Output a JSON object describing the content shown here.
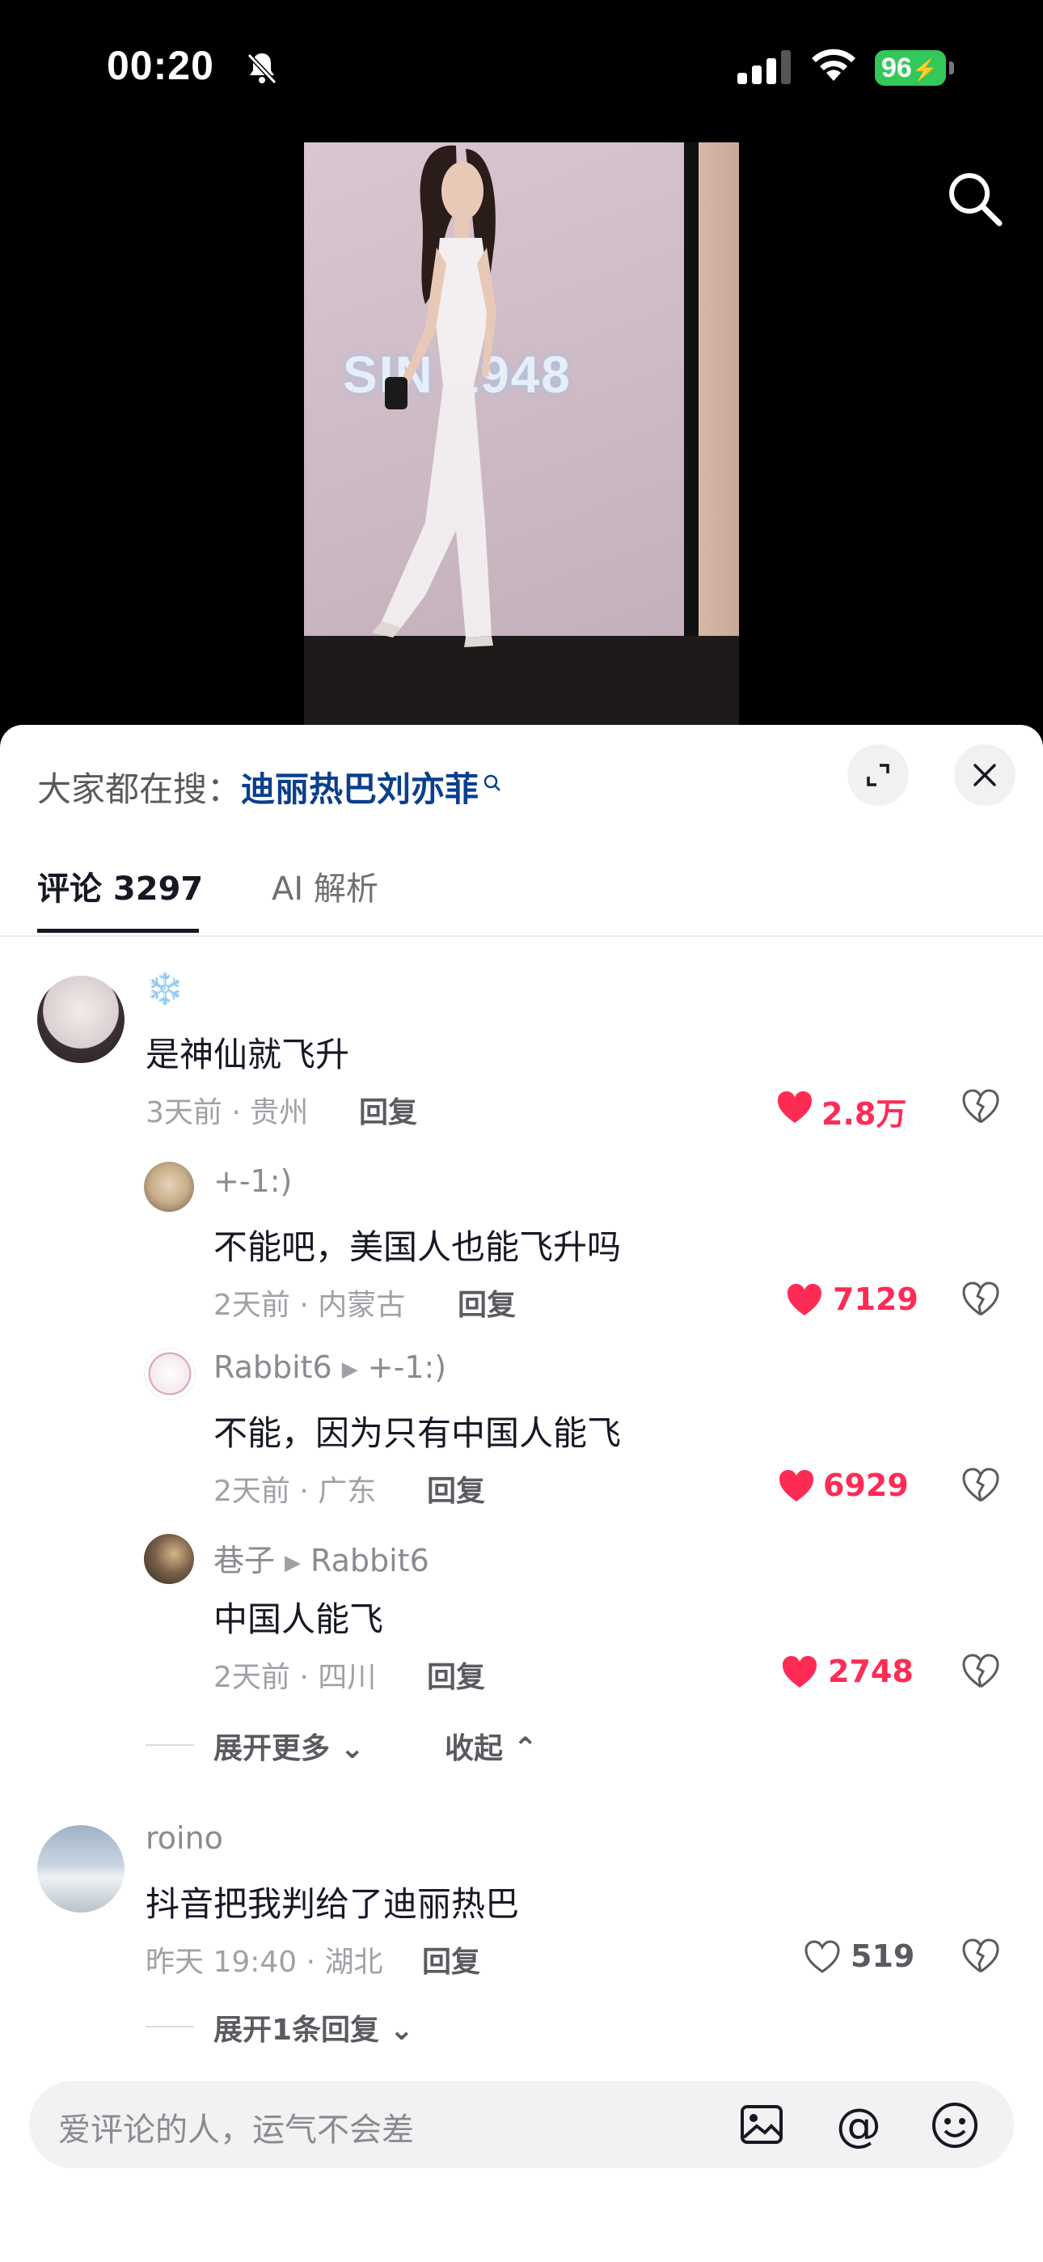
{
  "status_bar": {
    "time": "00:20",
    "battery": "96"
  },
  "video": {
    "sign_text": "SIN  1948"
  },
  "sheet": {
    "trending_prefix": "大家都在搜：",
    "trending_keyword": "迪丽热巴刘亦菲",
    "tabs": [
      {
        "label": "评论 3297",
        "active": true
      },
      {
        "label": "AI 解析",
        "active": false
      }
    ],
    "comments": [
      {
        "user": "❄️",
        "text": "是神仙就飞升",
        "meta": "3天前 · 贵州",
        "reply_label": "回复",
        "likes": "2.8万",
        "liked": true,
        "replies": [
          {
            "user": "+-1:)",
            "reply_to": "",
            "text": "不能吧，美国人也能飞升吗",
            "meta": "2天前 · 内蒙古",
            "reply_label": "回复",
            "likes": "7129",
            "liked": true
          },
          {
            "user": "Rabbit6",
            "reply_to": "+-1:)",
            "text": "不能，因为只有中国人能飞",
            "meta": "2天前 · 广东",
            "reply_label": "回复",
            "likes": "6929",
            "liked": true
          },
          {
            "user": "巷子",
            "reply_to": "Rabbit6",
            "text": "中国人能飞",
            "meta": "2天前 · 四川",
            "reply_label": "回复",
            "likes": "2748",
            "liked": true
          }
        ],
        "expand_more": "展开更多",
        "collapse": "收起"
      },
      {
        "user": "roino",
        "text": "抖音把我判给了迪丽热巴",
        "meta": "昨天 19:40 · 湖北",
        "reply_label": "回复",
        "likes": "519",
        "liked": false,
        "expand_replies": "展开1条回复"
      }
    ],
    "input_placeholder": "爱评论的人，运气不会差"
  },
  "colors": {
    "like_red": "#fe2c55",
    "keyword_blue": "#0b3f8d",
    "battery_green": "#34c759"
  }
}
